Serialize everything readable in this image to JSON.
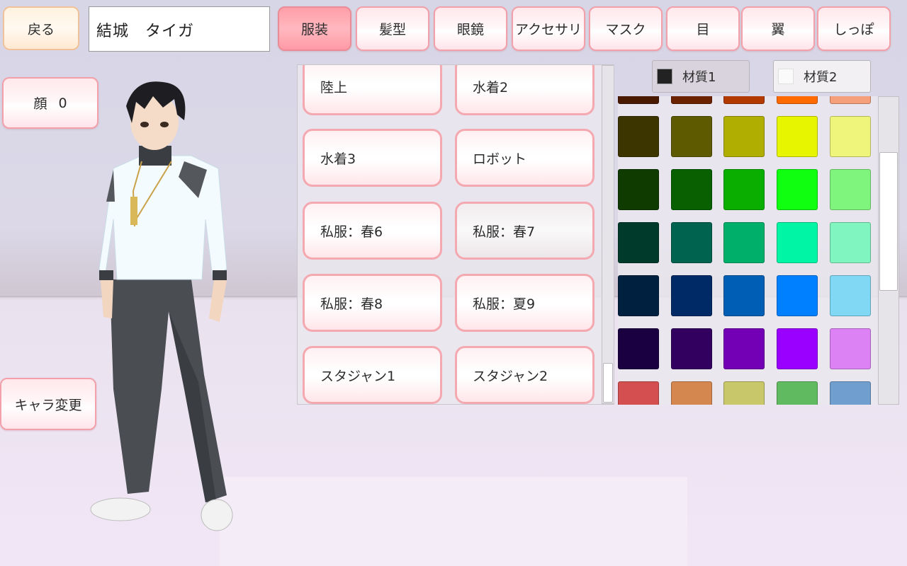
{
  "header": {
    "back_label": "戻る",
    "character_name": "結城　タイガ",
    "tabs": [
      {
        "label": "服装",
        "active": true
      },
      {
        "label": "髪型",
        "active": false
      },
      {
        "label": "眼鏡",
        "active": false
      },
      {
        "label": "アクセサリ",
        "active": false
      },
      {
        "label": "マスク",
        "active": false
      },
      {
        "label": "目",
        "active": false
      },
      {
        "label": "翼",
        "active": false
      },
      {
        "label": "しっぽ",
        "active": false
      }
    ]
  },
  "side": {
    "face_label": "顔",
    "face_value": "0",
    "change_char_label": "キャラ変更"
  },
  "outfits": {
    "items": [
      {
        "label": "陸上"
      },
      {
        "label": "水着2"
      },
      {
        "label": "水着3"
      },
      {
        "label": "ロボット"
      },
      {
        "label": "私服：春6"
      },
      {
        "label": "私服：春7"
      },
      {
        "label": "私服：春8"
      },
      {
        "label": "私服：夏9"
      },
      {
        "label": "スタジャン1"
      },
      {
        "label": "スタジャン2"
      }
    ]
  },
  "materials": {
    "tabs": [
      {
        "label": "材質1",
        "swatch": "#222222",
        "active": true
      },
      {
        "label": "材質2",
        "swatch": "#fafafa",
        "active": false
      }
    ]
  },
  "palette": {
    "rows": [
      [
        "#4a1a00",
        "#6a2200",
        "#b23a00",
        "#ff6a00",
        "#f5a07a"
      ],
      [
        "#3d3500",
        "#5e5a00",
        "#b0ae00",
        "#e8f500",
        "#eef57a"
      ],
      [
        "#0f3a00",
        "#096000",
        "#0aae00",
        "#10ff10",
        "#80f57e"
      ],
      [
        "#003a2a",
        "#006350",
        "#00b06a",
        "#00f5a5",
        "#80f5bf"
      ],
      [
        "#002040",
        "#002a66",
        "#005eb5",
        "#0080ff",
        "#80d8f5"
      ],
      [
        "#1a0040",
        "#32005e",
        "#7400b5",
        "#9a00ff",
        "#dc82f5"
      ],
      [
        "#d45050",
        "#d48850",
        "#c8c86a",
        "#60bb60",
        "#6f9ecf"
      ]
    ]
  }
}
